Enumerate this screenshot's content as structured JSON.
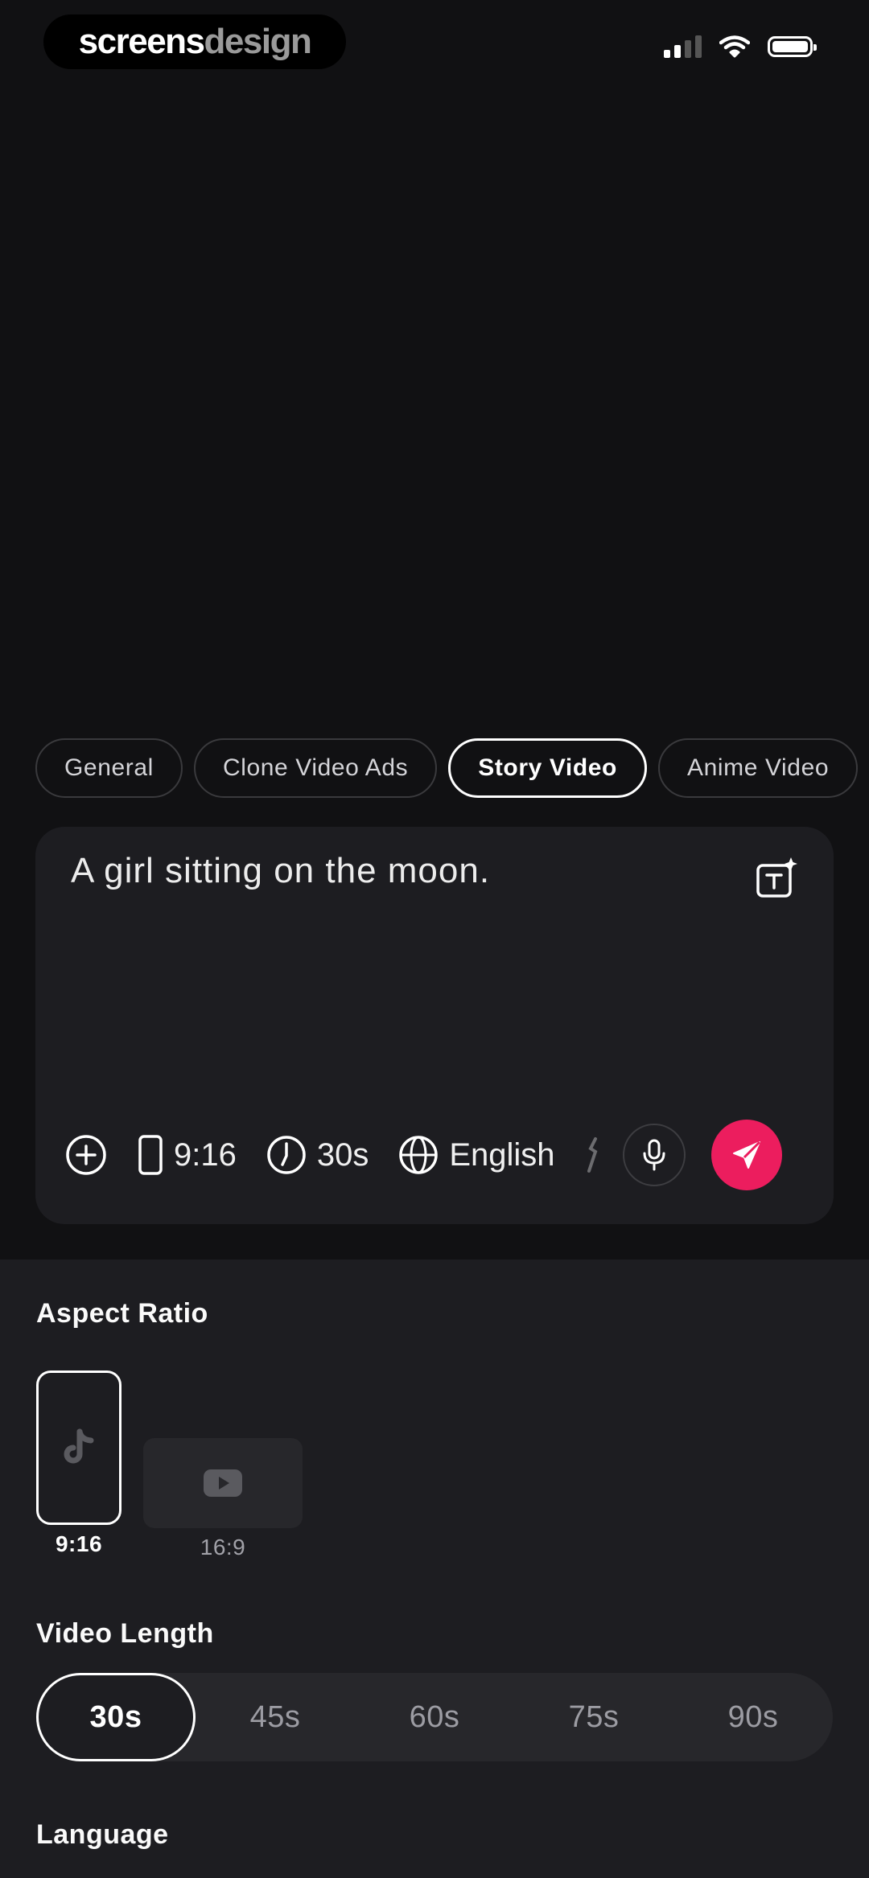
{
  "status_bar": {
    "brand_part1": "screens",
    "brand_part2": "design"
  },
  "categories": [
    {
      "label": "General",
      "active": false
    },
    {
      "label": "Clone Video Ads",
      "active": false
    },
    {
      "label": "Story Video",
      "active": true
    },
    {
      "label": "Anime Video",
      "active": false
    }
  ],
  "prompt": {
    "text": "A girl sitting on the moon.",
    "aspect_ratio": "9:16",
    "duration": "30s",
    "language": "English"
  },
  "sheet": {
    "aspect_ratio_title": "Aspect Ratio",
    "aspect_options": [
      {
        "label": "9:16",
        "icon": "tiktok-icon",
        "selected": true
      },
      {
        "label": "16:9",
        "icon": "youtube-icon",
        "selected": false
      }
    ],
    "video_length_title": "Video Length",
    "length_options": [
      {
        "label": "30s",
        "selected": true
      },
      {
        "label": "45s",
        "selected": false
      },
      {
        "label": "60s",
        "selected": false
      },
      {
        "label": "75s",
        "selected": false
      },
      {
        "label": "90s",
        "selected": false
      }
    ],
    "language_title": "Language"
  },
  "colors": {
    "accent": "#EC1D5E",
    "background": "#111113",
    "surface": "#1D1D21"
  }
}
